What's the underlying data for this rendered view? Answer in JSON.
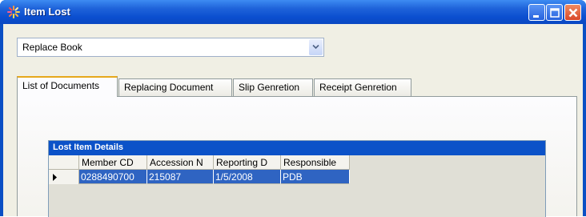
{
  "window": {
    "title": "Item Lost"
  },
  "combo": {
    "value": "Replace Book"
  },
  "tabs": [
    {
      "label": "List of Documents",
      "active": true
    },
    {
      "label": "Replacing Document",
      "active": false
    },
    {
      "label": "Slip Genretion",
      "active": false
    },
    {
      "label": "Receipt Genretion",
      "active": false
    }
  ],
  "grid": {
    "caption": "Lost Item Details",
    "columns": [
      "Member CD",
      "Accession N",
      "Reporting D",
      "Responsible"
    ],
    "rows": [
      [
        "0288490700",
        "215087",
        "1/5/2008",
        "PDB"
      ]
    ]
  },
  "colors": {
    "title_bar": "#0b4fd0",
    "grid_caption": "#0b52c8",
    "selected_row": "#2f64c2",
    "active_tab_accent": "#e6a81c"
  }
}
